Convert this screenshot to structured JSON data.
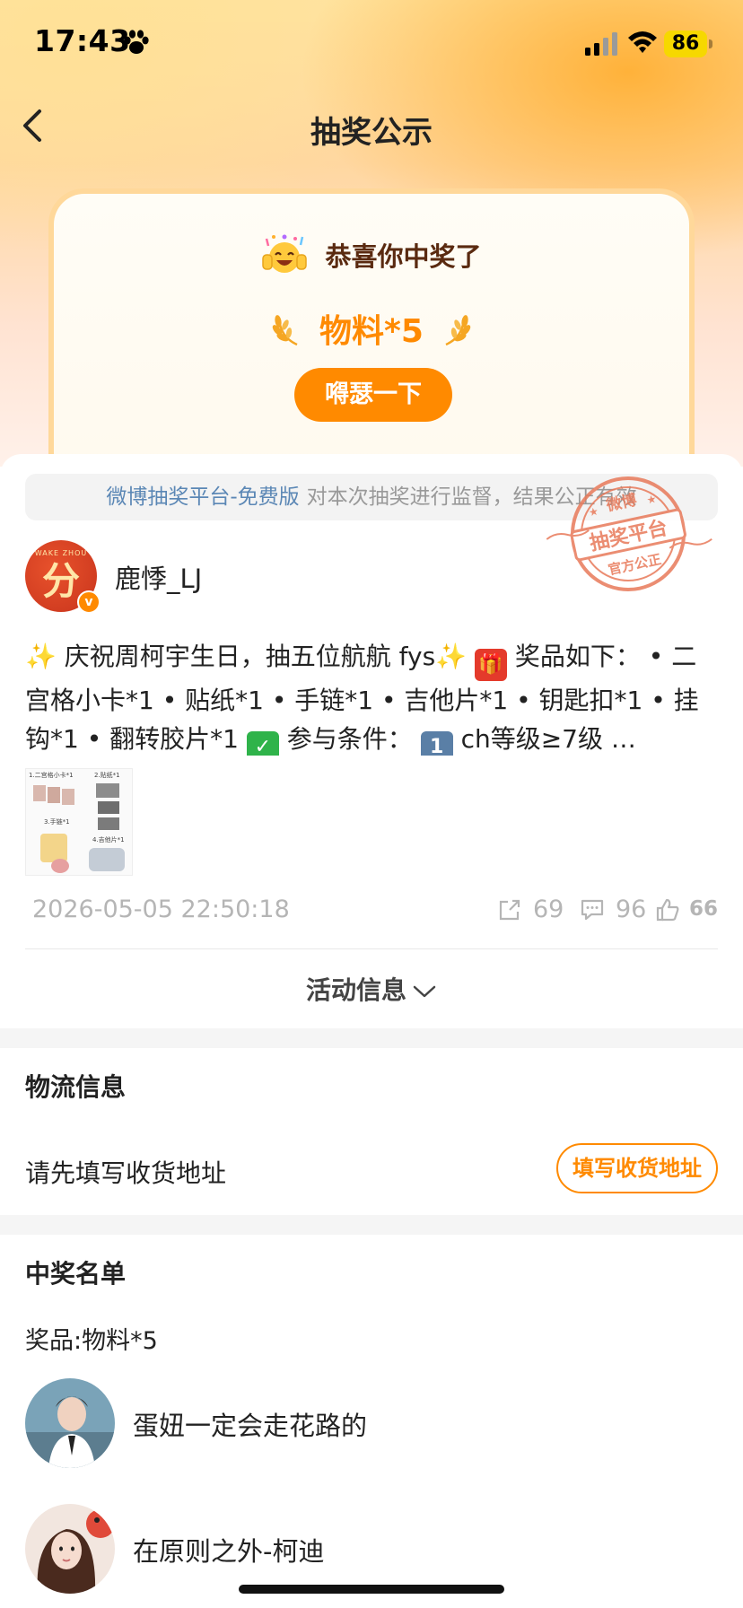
{
  "status_bar": {
    "time": "17:43",
    "battery": "86"
  },
  "nav": {
    "title": "抽奖公示"
  },
  "prize_card": {
    "congrats": "恭喜你中奖了",
    "prize": "物料*5",
    "brag_button": "嘚瑟一下"
  },
  "notice": {
    "platform": "微博抽奖平台-免费版",
    "description": "对本次抽奖进行监督，结果公正有效"
  },
  "post": {
    "author": "鹿悸_LJ",
    "avatar_char": "分",
    "avatar_top_text": "WAKE ZHOU",
    "stamp": {
      "top": "微博",
      "middle": "抽奖平台",
      "bottom": "官方公正"
    },
    "text": {
      "part1": " 庆祝周柯宇生日，抽五位航航 fys",
      "part2": " 奖品如下： • 二宫格小卡*1 • 贴纸*1 • 手链*1 • 吉他片*1 • 钥匙扣*1 • 挂钩*1 • 翻转胶片*1 ",
      "part3": " 参与条件： ",
      "part4": " ch等级≥7级 …"
    },
    "thumbnail_labels": [
      "1.二宫格小卡*1",
      "2.贴纸*1",
      "3.手链*1",
      "4.吉他片*1"
    ],
    "datetime": "2026-05-05 22:50:18",
    "shares": "69",
    "comments": "96",
    "likes": "66"
  },
  "activity_info": "活动信息",
  "logistics": {
    "title": "物流信息",
    "message": "请先填写收货地址",
    "button": "填写收货地址"
  },
  "winners": {
    "title": "中奖名单",
    "prize_line": "奖品:物料*5",
    "list": [
      {
        "name": "蛋妞一定会走花路的"
      },
      {
        "name": "在原则之外-柯迪"
      }
    ]
  },
  "colors": {
    "accent": "#ff8a00",
    "link": "#5b87b5",
    "stamp": "#e87a5a"
  }
}
